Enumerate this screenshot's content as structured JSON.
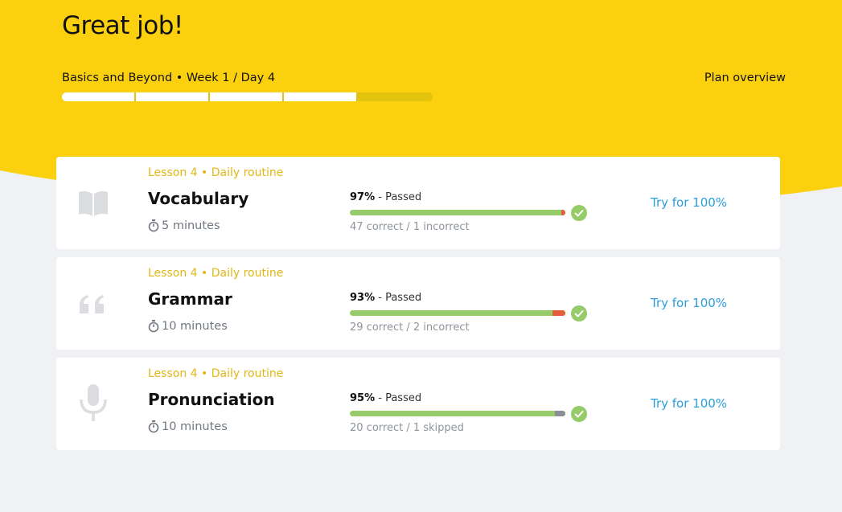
{
  "header": {
    "title": "Great job!",
    "plan_label": "Basics and Beyond • Week 1 / Day 4",
    "plan_overview": "Plan overview",
    "days_completed": 4,
    "days_total": 5
  },
  "colors": {
    "hero_yellow": "#fbd00e",
    "page_bg": "#f0f1f5",
    "lesson_label": "#e0b716",
    "pass_green": "#96cb6a",
    "incorrect_red": "#e35f3b",
    "skipped_gray": "#8c8f95",
    "link_blue": "#2a9fdc"
  },
  "cards": [
    {
      "icon": "book-icon",
      "lesson": "Lesson 4 • Daily routine",
      "name": "Vocabulary",
      "duration": "5 minutes",
      "score": "97%",
      "status": "- Passed",
      "progress_percent": 98,
      "tail_type": "incorrect",
      "stats": "47 correct / 1 incorrect",
      "action": "Try for 100%"
    },
    {
      "icon": "quote-icon",
      "lesson": "Lesson 4 • Daily routine",
      "name": "Grammar",
      "duration": "10 minutes",
      "score": "93%",
      "status": "- Passed",
      "progress_percent": 94,
      "tail_type": "incorrect",
      "stats": "29 correct / 2 incorrect",
      "action": "Try for 100%"
    },
    {
      "icon": "microphone-icon",
      "lesson": "Lesson 4 • Daily routine",
      "name": "Pronunciation",
      "duration": "10 minutes",
      "score": "95%",
      "status": "- Passed",
      "progress_percent": 95,
      "tail_type": "skipped",
      "stats": "20 correct / 1 skipped",
      "action": "Try for 100%"
    }
  ]
}
